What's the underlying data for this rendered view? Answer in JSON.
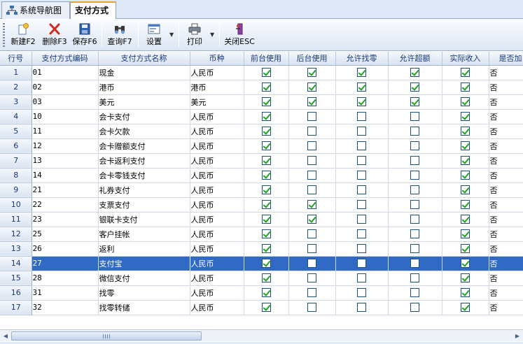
{
  "tabs": [
    {
      "label": "系统导航图",
      "icon": "sitemap-icon"
    },
    {
      "label": "支付方式",
      "active": true
    }
  ],
  "toolbar": {
    "new_label": "新建F2",
    "delete_label": "删除F3",
    "save_label": "保存F6",
    "query_label": "查询F7",
    "settings_label": "设置",
    "print_label": "打印",
    "close_label": "关闭ESC"
  },
  "grid": {
    "columns": [
      "行号",
      "支付方式编码",
      "支付方式名称",
      "币种",
      "前台使用",
      "后台使用",
      "允许找零",
      "允许超额",
      "实际收入",
      "是否加"
    ],
    "rows": [
      {
        "n": "1",
        "code": "01",
        "name": "现金",
        "currency": "人民币",
        "front": true,
        "back": true,
        "change": true,
        "over": true,
        "income": true,
        "extra": "否"
      },
      {
        "n": "2",
        "code": "02",
        "name": "港币",
        "currency": "港币",
        "front": true,
        "back": true,
        "change": true,
        "over": true,
        "income": true,
        "extra": "否"
      },
      {
        "n": "3",
        "code": "03",
        "name": "美元",
        "currency": "美元",
        "front": true,
        "back": true,
        "change": true,
        "over": true,
        "income": true,
        "extra": "否"
      },
      {
        "n": "4",
        "code": "10",
        "name": "会卡支付",
        "currency": "人民币",
        "front": true,
        "back": false,
        "change": false,
        "over": false,
        "income": true,
        "extra": "否"
      },
      {
        "n": "5",
        "code": "11",
        "name": "会卡欠款",
        "currency": "人民币",
        "front": true,
        "back": false,
        "change": false,
        "over": false,
        "income": true,
        "extra": "否"
      },
      {
        "n": "6",
        "code": "12",
        "name": "会卡赠额支付",
        "currency": "人民币",
        "front": true,
        "back": false,
        "change": false,
        "over": false,
        "income": true,
        "extra": "否"
      },
      {
        "n": "7",
        "code": "13",
        "name": "会卡返利支付",
        "currency": "人民币",
        "front": true,
        "back": false,
        "change": false,
        "over": false,
        "income": true,
        "extra": "否"
      },
      {
        "n": "8",
        "code": "14",
        "name": "会卡零钱支付",
        "currency": "人民币",
        "front": true,
        "back": false,
        "change": false,
        "over": false,
        "income": true,
        "extra": "否"
      },
      {
        "n": "9",
        "code": "21",
        "name": "礼券支付",
        "currency": "人民币",
        "front": true,
        "back": false,
        "change": false,
        "over": false,
        "income": true,
        "extra": "否"
      },
      {
        "n": "10",
        "code": "22",
        "name": "支票支付",
        "currency": "人民币",
        "front": true,
        "back": true,
        "change": false,
        "over": false,
        "income": true,
        "extra": "否"
      },
      {
        "n": "11",
        "code": "23",
        "name": "银联卡支付",
        "currency": "人民币",
        "front": true,
        "back": true,
        "change": false,
        "over": false,
        "income": true,
        "extra": "否"
      },
      {
        "n": "12",
        "code": "25",
        "name": "客户挂帐",
        "currency": "人民币",
        "front": true,
        "back": false,
        "change": false,
        "over": false,
        "income": true,
        "extra": "否"
      },
      {
        "n": "13",
        "code": "26",
        "name": "返利",
        "currency": "人民币",
        "front": true,
        "back": false,
        "change": false,
        "over": false,
        "income": true,
        "extra": "否"
      },
      {
        "n": "14",
        "code": "27",
        "name": "支付宝",
        "currency": "人民币",
        "front": true,
        "back": false,
        "change": false,
        "over": false,
        "income": true,
        "extra": "否",
        "selected": true
      },
      {
        "n": "15",
        "code": "28",
        "name": "微信支付",
        "currency": "人民币",
        "front": true,
        "back": false,
        "change": false,
        "over": false,
        "income": true,
        "extra": "否"
      },
      {
        "n": "16",
        "code": "31",
        "name": "找零",
        "currency": "人民币",
        "front": true,
        "back": false,
        "change": false,
        "over": false,
        "income": true,
        "extra": "否"
      },
      {
        "n": "17",
        "code": "32",
        "name": "找零转储",
        "currency": "人民币",
        "front": true,
        "back": false,
        "change": false,
        "over": false,
        "income": true,
        "extra": "否"
      }
    ]
  }
}
